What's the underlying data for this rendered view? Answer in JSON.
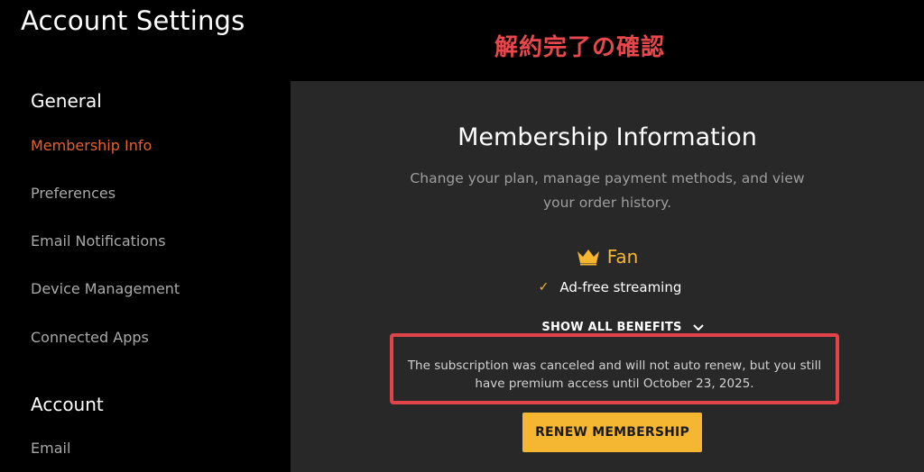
{
  "header": {
    "title": "Account Settings"
  },
  "annotation": {
    "text": "解約完了の確認",
    "color": "#e8474b"
  },
  "sidebar": {
    "sections": [
      {
        "heading": "General",
        "items": [
          {
            "label": "Membership Info",
            "active": true
          },
          {
            "label": "Preferences",
            "active": false
          },
          {
            "label": "Email Notifications",
            "active": false
          },
          {
            "label": "Device Management",
            "active": false
          },
          {
            "label": "Connected Apps",
            "active": false
          }
        ]
      },
      {
        "heading": "Account",
        "items": [
          {
            "label": "Email",
            "active": false
          }
        ]
      }
    ]
  },
  "main": {
    "title": "Membership Information",
    "subtitle": "Change your plan, manage payment methods, and view your order history.",
    "plan": {
      "icon": "crown-icon",
      "name": "Fan"
    },
    "benefits": [
      {
        "icon": "check-icon",
        "text": "Ad-free streaming"
      }
    ],
    "show_benefits_label": "SHOW ALL BENEFITS",
    "notice": "The subscription was canceled and will not auto renew, but you still have premium access until October 23, 2025.",
    "renew_button_label": "RENEW MEMBERSHIP"
  },
  "colors": {
    "accent_active": "#e5622d",
    "plan_gold": "#f5b731",
    "notice_border": "#e04449",
    "panel_bg": "#282828"
  }
}
